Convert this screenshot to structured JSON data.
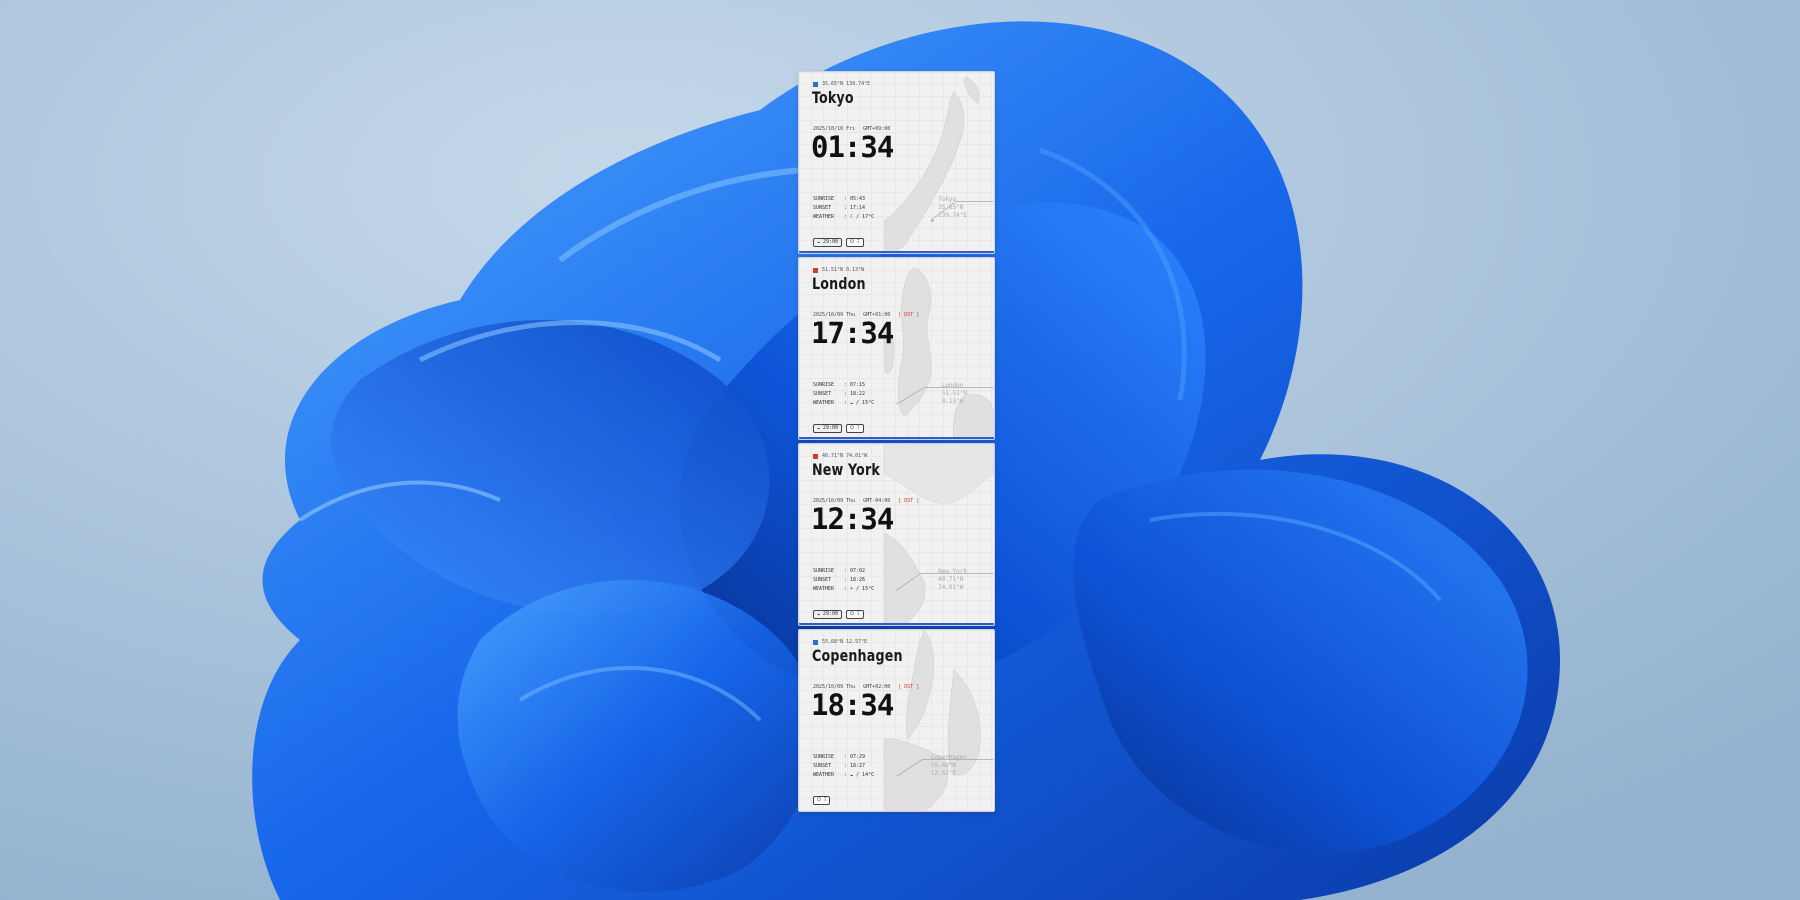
{
  "cities": [
    {
      "name": "Tokyo",
      "coords": "35.65°N  139.74°E",
      "marker_color": "#2b6fd6",
      "date": "2025/10/10 Fri",
      "gmt": "GMT+09:00",
      "dst": "",
      "time": "01:34",
      "sunrise": "05:43",
      "sunset": "17:14",
      "weather": "☾ / 17°C",
      "map_label": [
        "Tokyo",
        "35.65°N",
        "139.74°E"
      ],
      "tags": [
        "☁ 29:00",
        "⏻ ⁑"
      ],
      "bar_color": "#2b5fd0"
    },
    {
      "name": "London",
      "coords": "51.51°N  0.13°W",
      "marker_color": "#d23a2e",
      "date": "2025/10/09 Thu",
      "gmt": "GMT+01:00",
      "dst": "[ DST ]",
      "time": "17:34",
      "sunrise": "07:15",
      "sunset": "18:22",
      "weather": "☁ / 15°C",
      "map_label": [
        "London",
        "51.51°N",
        "0.13°W"
      ],
      "tags": [
        "☁ 29:00",
        "⏻ ⁑"
      ],
      "bar_color": "#2b5fd0"
    },
    {
      "name": "New York",
      "coords": "40.71°N  74.01°W",
      "marker_color": "#d23a2e",
      "date": "2025/10/09 Thu",
      "gmt": "GMT-04:00",
      "dst": "[ DST ]",
      "time": "12:34",
      "sunrise": "07:02",
      "sunset": "18:26",
      "weather": "☀ / 15°C",
      "map_label": [
        "New York",
        "40.71°N",
        "74.01°W"
      ],
      "tags": [
        "☁ 29:00",
        "⏻ ⁑"
      ],
      "bar_color": "#2b5fd0"
    },
    {
      "name": "Copenhagen",
      "coords": "55.68°N  12.57°E",
      "marker_color": "#2b6fd6",
      "date": "2025/10/09 Thu",
      "gmt": "GMT+02:00",
      "dst": "[ DST ]",
      "time": "18:34",
      "sunrise": "07:29",
      "sunset": "18:27",
      "weather": "☁ / 14°C",
      "map_label": [
        "Copenhagen",
        "55.68°N",
        "12.57°E"
      ],
      "tags": [
        "⏻ ⁑"
      ],
      "bar_color": ""
    }
  ],
  "labels": {
    "sunrise": "SUNRISE",
    "sunset": "SUNSET",
    "weather": "WEATHER"
  }
}
